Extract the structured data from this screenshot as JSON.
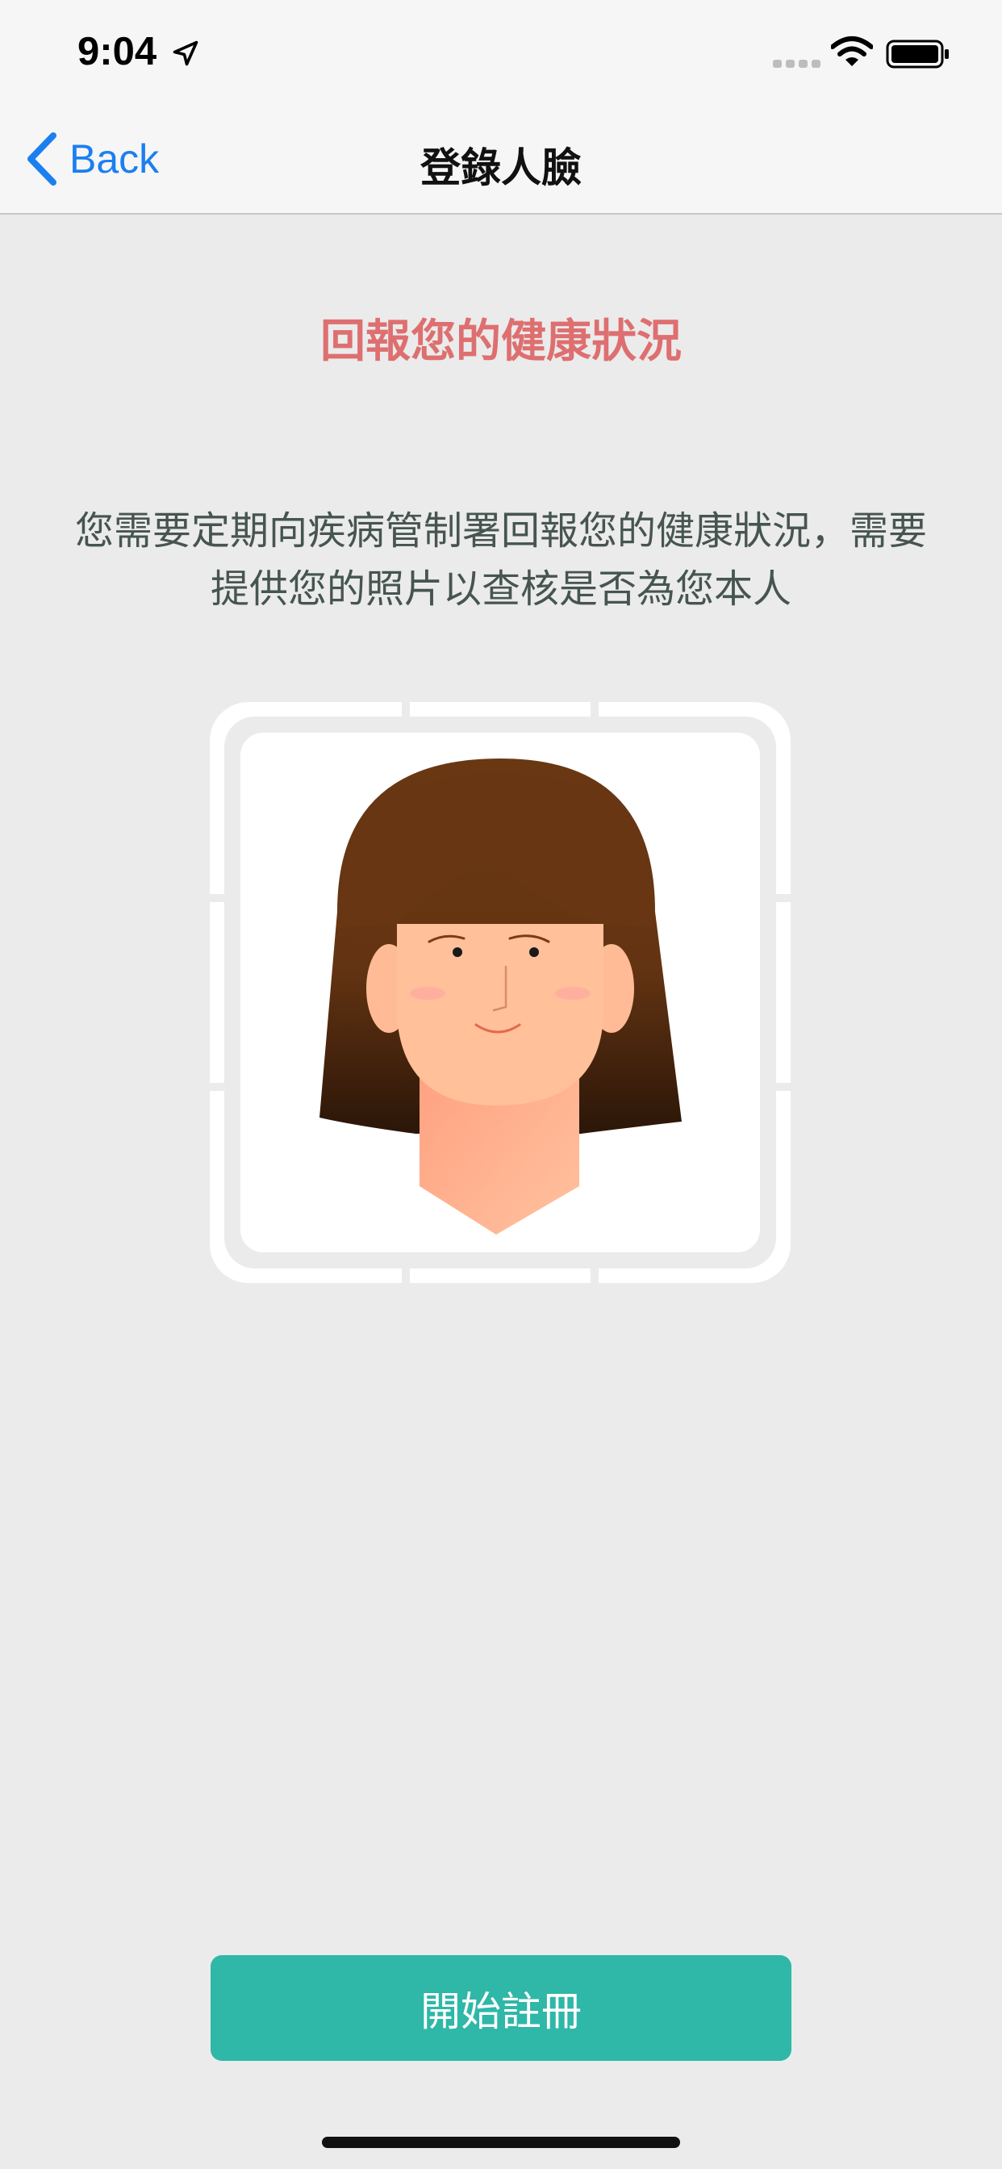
{
  "status_bar": {
    "time": "9:04",
    "icons": [
      "location-arrow-icon",
      "cellular-signal-icon",
      "wifi-icon",
      "battery-icon"
    ]
  },
  "nav": {
    "back_label": "Back",
    "title": "登錄人臉"
  },
  "main": {
    "heading": "回報您的健康狀況",
    "description_line1": "您需要定期向疾病管制署回報您的健康狀況，需要",
    "description_line2": "提供您的照片以查核是否為您本人",
    "illustration": "face-illustration"
  },
  "actions": {
    "start_label": "開始註冊"
  },
  "colors": {
    "accent": "#1b7ff0",
    "heading": "#de6f70",
    "primary_button": "#2fb7a8",
    "background": "#ebebeb"
  }
}
